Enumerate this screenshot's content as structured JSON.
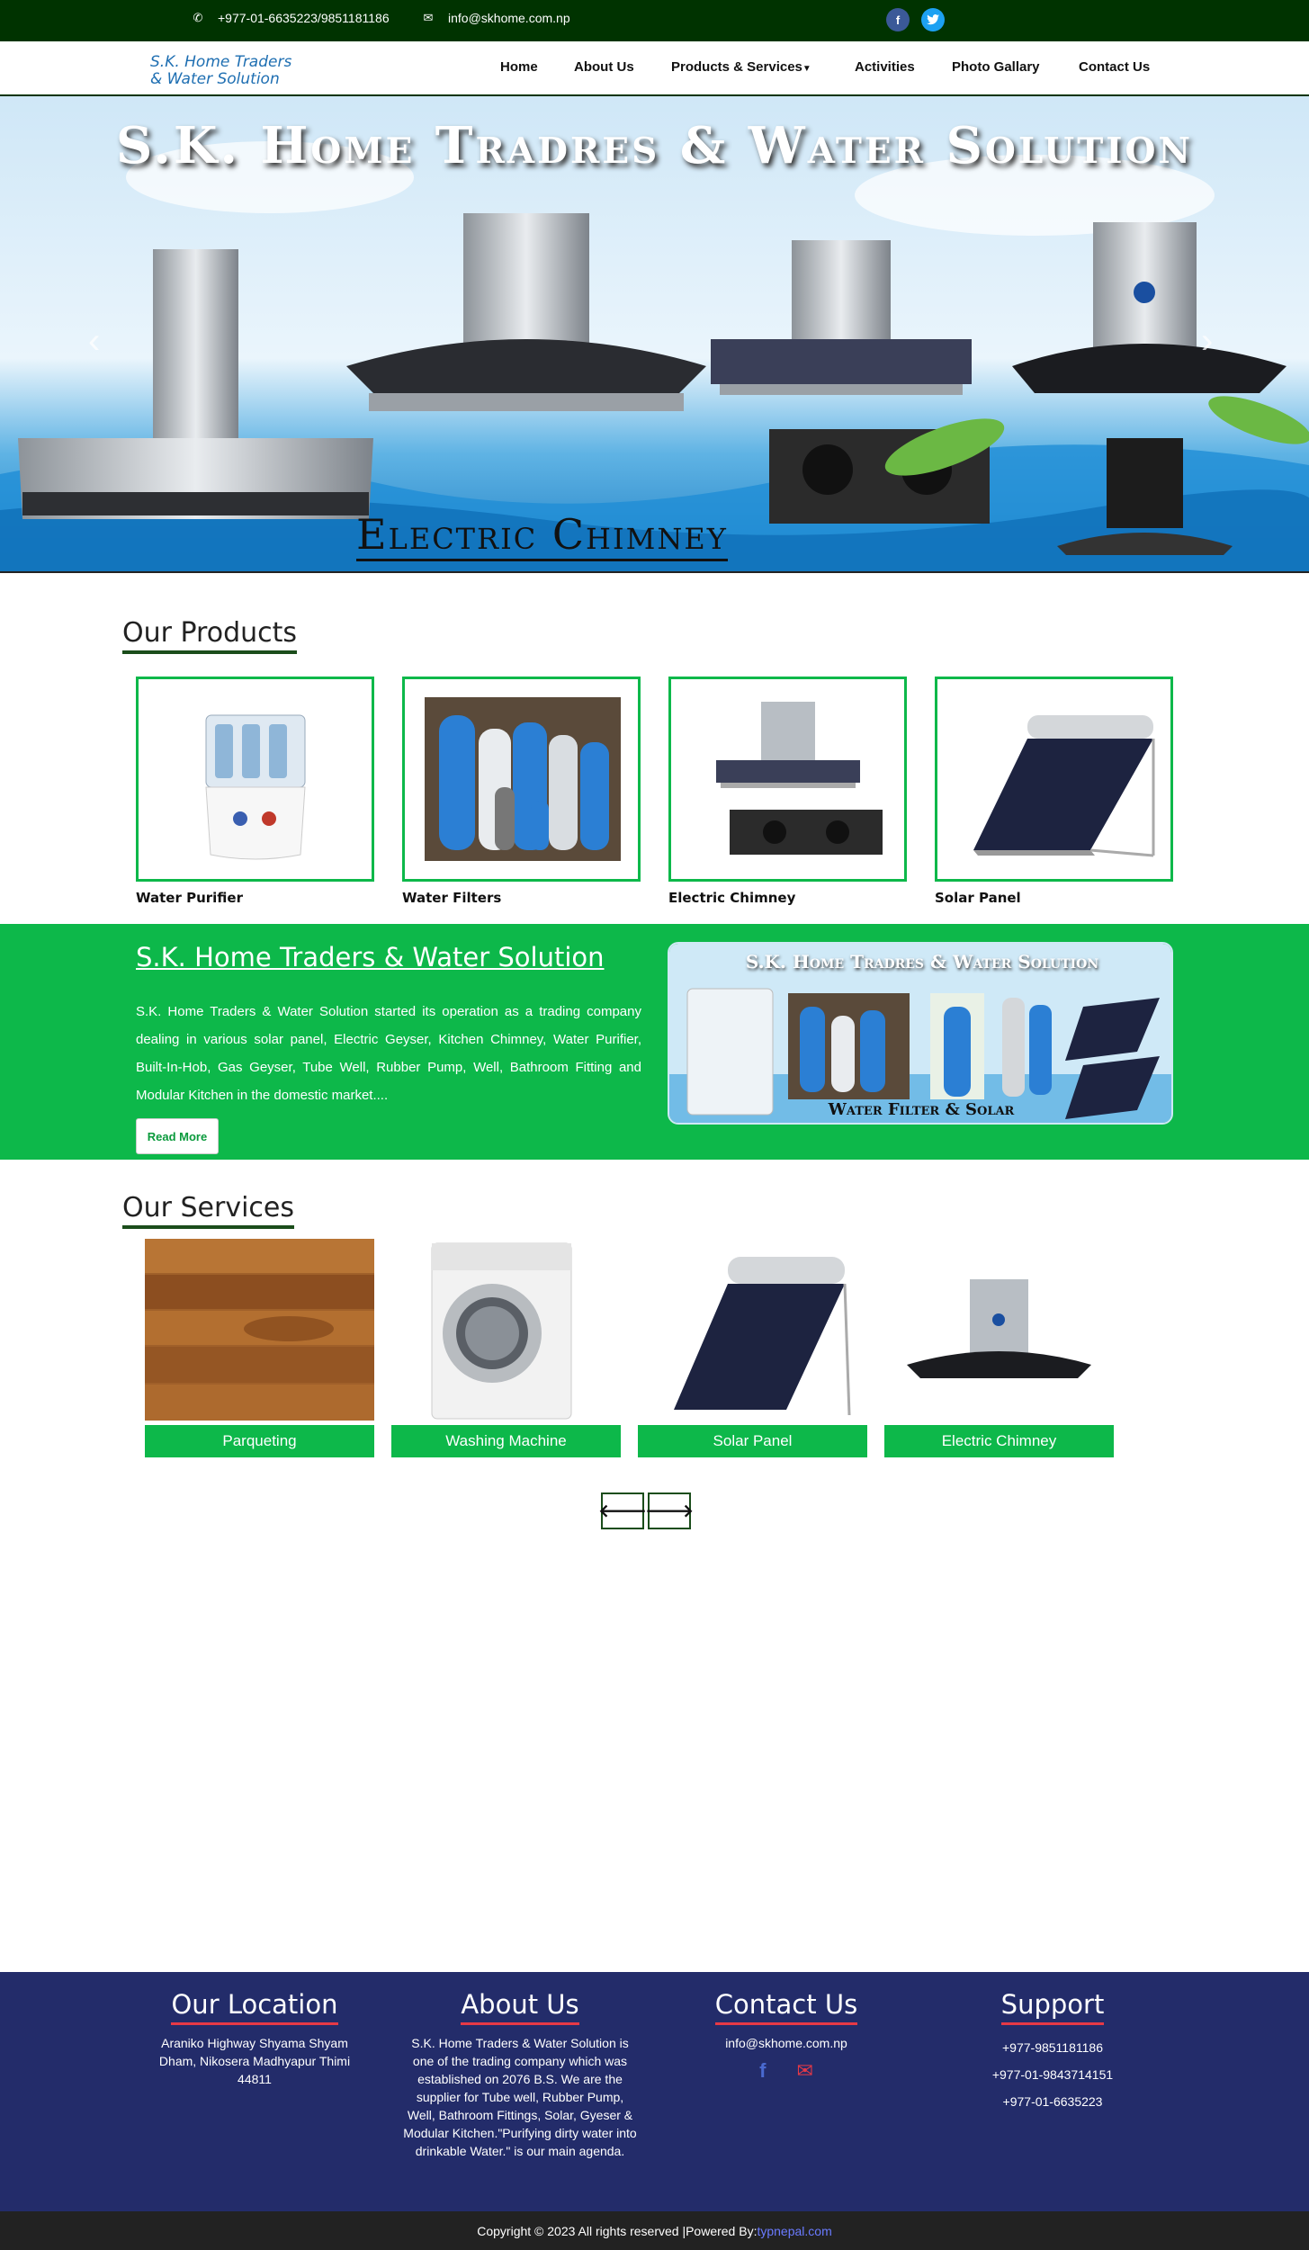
{
  "topbar": {
    "phone_icon": "phone-icon",
    "phone": "+977-01-6635223/9851181186",
    "email_icon": "envelope-icon",
    "email": "info@skhome.com.np",
    "social": [
      "facebook-icon",
      "twitter-icon"
    ]
  },
  "header": {
    "logo_line1": "S.K. Home Traders",
    "logo_line2": "& Water Solution",
    "nav": [
      "Home",
      "About Us",
      "Products & Services",
      "Activities",
      "Photo Gallary",
      "Contact Us"
    ]
  },
  "hero": {
    "title": "S.K. Home Tradres & Water Solution",
    "subtitle": "Electric Chimney"
  },
  "products": {
    "title": "Our Products",
    "items": [
      "Water Purifier",
      "Water Filters",
      "Electric Chimney",
      "Solar Panel"
    ]
  },
  "about": {
    "title": "S.K. Home Traders & Water Solution",
    "text": "S.K. Home Traders & Water Solution started its operation as a trading company dealing in various solar panel, Electric Geyser, Kitchen Chimney, Water Purifier, Built-In-Hob, Gas Geyser, Tube Well, Rubber Pump, Well, Bathroom Fitting and Modular Kitchen in the domestic market....",
    "button": "Read More",
    "image_title": "S.K. Home Tradres & Water Solution",
    "image_caption": "Water Filter & Solar"
  },
  "services": {
    "title": "Our Services",
    "items": [
      "Parqueting",
      "Washing Machine",
      "Solar Panel",
      "Electric Chimney"
    ],
    "prev_icon": "arrow-left-icon",
    "next_icon": "arrow-right-icon"
  },
  "footer": {
    "location_title": "Our Location",
    "location_text": "Araniko Highway Shyama Shyam Dham, Nikosera Madhyapur Thimi 44811",
    "about_title": "About Us",
    "about_text": "S.K. Home Traders & Water Solution is one of the trading company which was established on 2076 B.S. We are the supplier for Tube well, Rubber Pump, Well, Bathroom Fittings, Solar, Gyeser & Modular Kitchen.\"Purifying dirty water into drinkable Water.\" is our main agenda.",
    "contact_title": "Contact Us",
    "contact_email": "info@skhome.com.np",
    "support_title": "Support",
    "support_phones": [
      "+977-9851181186",
      "+977-01-9843714151",
      "+977-01-6635223"
    ],
    "copyright": "Copyright © 2023 All rights reserved |Powered By:",
    "powered_by": "typnepal.com"
  },
  "colors": {
    "topbar": "#003300",
    "accent_green": "#0db84a",
    "footer": "#232c6a",
    "footer_underline": "#e63946"
  }
}
